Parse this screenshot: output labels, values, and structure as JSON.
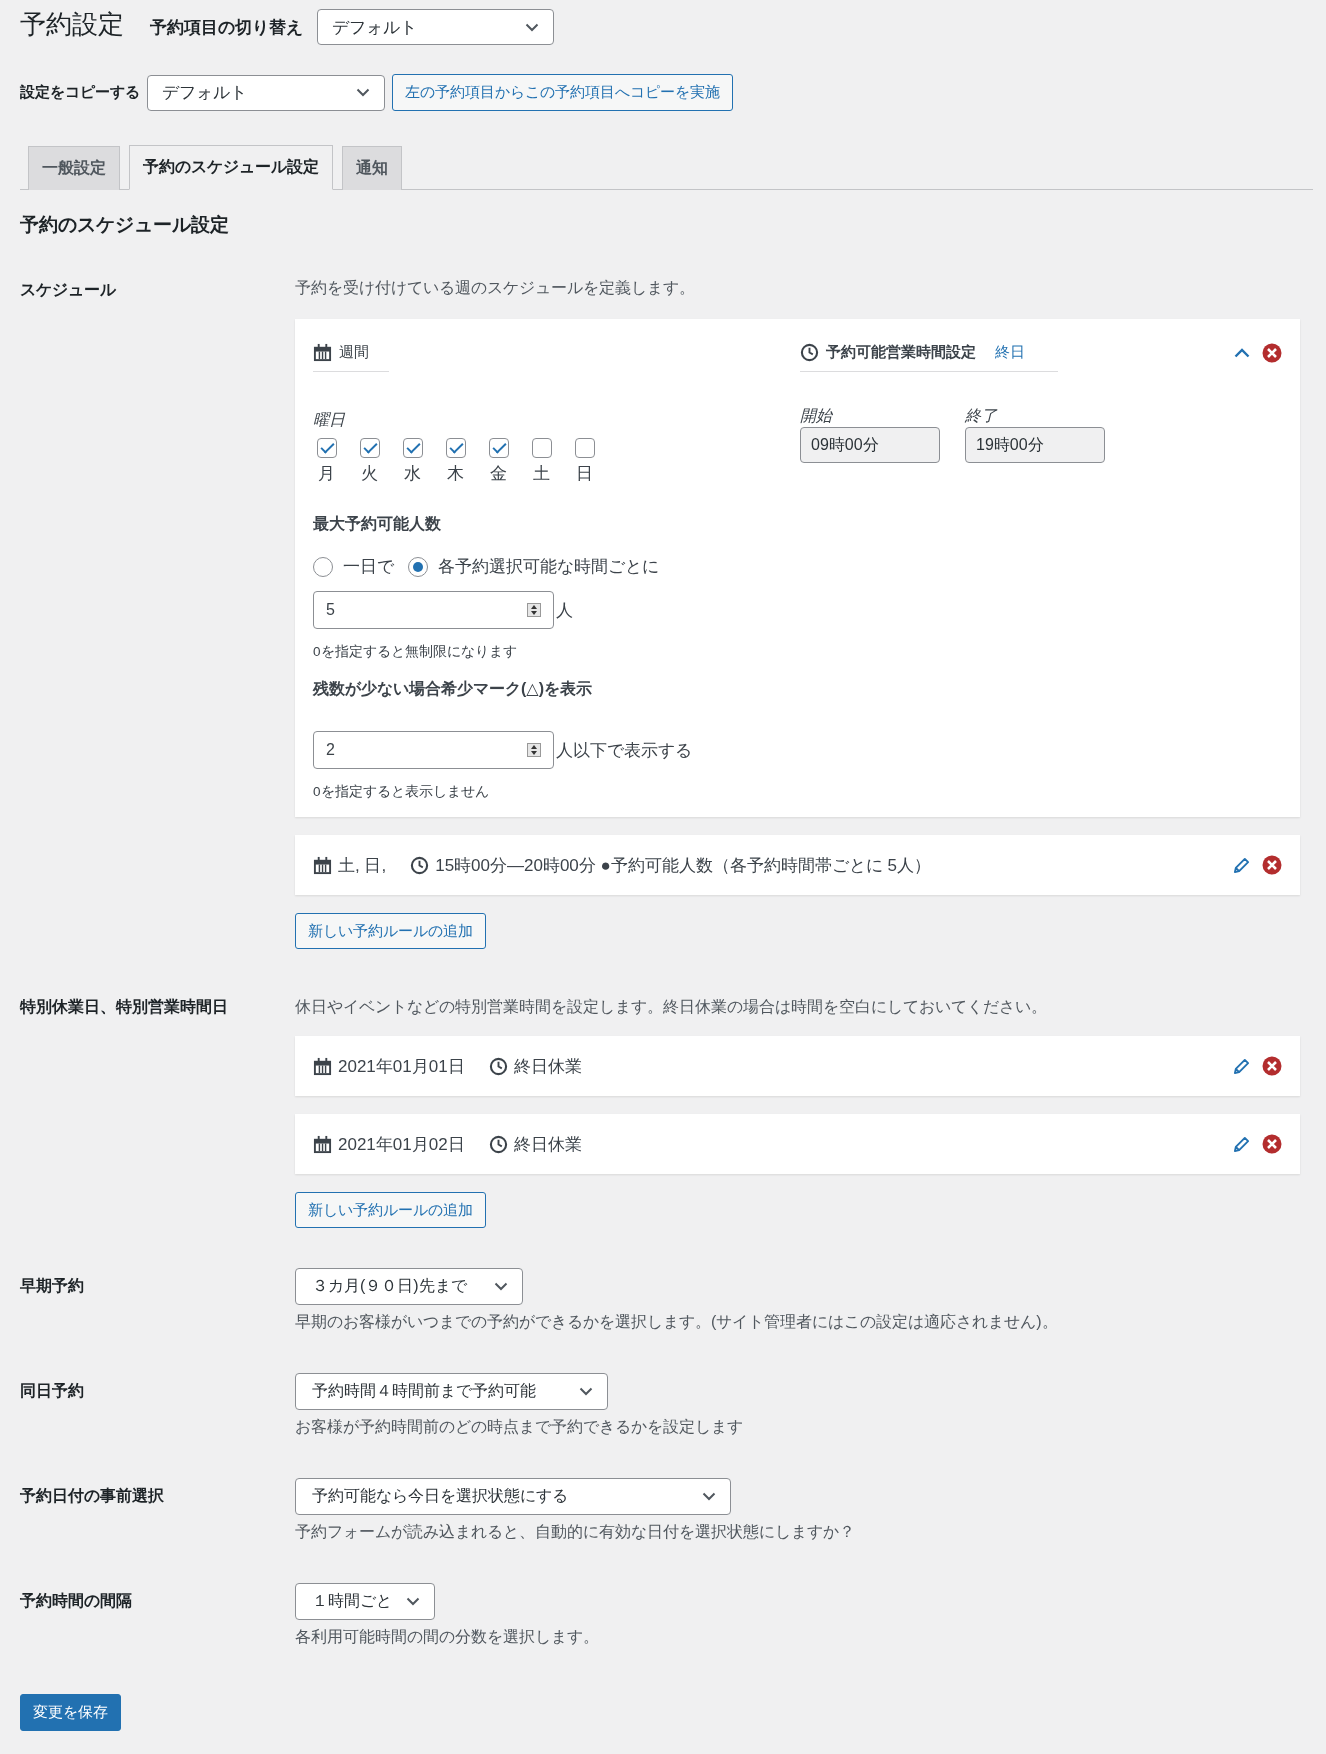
{
  "page_title": "予約設定",
  "item_switch": {
    "label": "予約項目の切り替え",
    "value": "デフォルト"
  },
  "copy": {
    "label": "設定をコピーする",
    "value": "デフォルト",
    "button": "左の予約項目からこの予約項目へコピーを実施"
  },
  "tabs": [
    {
      "label": "一般設定",
      "selected": false
    },
    {
      "label": "予約のスケジュール設定",
      "selected": true
    },
    {
      "label": "通知",
      "selected": false
    }
  ],
  "section_title": "予約のスケジュール設定",
  "schedule": {
    "label": "スケジュール",
    "description": "予約を受け付けている週のスケジュールを定義します。",
    "editor": {
      "week_title": "週間",
      "hours_title": "予約可能営業時間設定",
      "hours_link": "終日",
      "weekday_label": "曜日",
      "days": [
        {
          "label": "月",
          "checked": true
        },
        {
          "label": "火",
          "checked": true
        },
        {
          "label": "水",
          "checked": true
        },
        {
          "label": "木",
          "checked": true
        },
        {
          "label": "金",
          "checked": true
        },
        {
          "label": "土",
          "checked": false
        },
        {
          "label": "日",
          "checked": false
        }
      ],
      "start": {
        "label": "開始",
        "value": "09時00分"
      },
      "end": {
        "label": "終了",
        "value": "19時00分"
      },
      "capacity": {
        "title": "最大予約可能人数",
        "options": [
          {
            "label": "一日で",
            "selected": false
          },
          {
            "label": "各予約選択可能な時間ごとに",
            "selected": true
          }
        ],
        "value": "5",
        "unit": "人",
        "hint": "0を指定すると無制限になります"
      },
      "scarcity": {
        "title": "残数が少ない場合希少マーク(△)を表示",
        "value": "2",
        "unit": "人以下で表示する",
        "hint": "0を指定すると表示しません"
      }
    },
    "rules": [
      {
        "days": "土, 日,",
        "time": "15時00分—20時00分 ●予約可能人数（各予約時間帯ごとに 5人）"
      }
    ],
    "add_button": "新しい予約ルールの追加"
  },
  "exceptions": {
    "label": "特別休業日、特別営業時間日",
    "description": "休日やイベントなどの特別営業時間を設定します。終日休業の場合は時間を空白にしておいてください。",
    "rules": [
      {
        "days": "2021年01月01日",
        "time": "終日休業"
      },
      {
        "days": "2021年01月02日",
        "time": "終日休業"
      }
    ],
    "add_button": "新しい予約ルールの追加"
  },
  "settings": [
    {
      "label": "早期予約",
      "value": "３カ月(９０日)先まで",
      "hint": "早期のお客様がいつまでの予約ができるかを選択します。(サイト管理者にはこの設定は適応されません)。"
    },
    {
      "label": "同日予約",
      "value": "予約時間４時間前まで予約可能",
      "hint": "お客様が予約時間前のどの時点まで予約できるかを設定します"
    },
    {
      "label": "予約日付の事前選択",
      "value": "予約可能なら今日を選択状態にする",
      "hint": "予約フォームが読み込まれると、自動的に有効な日付を選択状態にしますか？"
    },
    {
      "label": "予約時間の間隔",
      "value": "１時間ごと",
      "hint": "各利用可能時間の間の分数を選択します。"
    }
  ],
  "save_button": "変更を保存"
}
